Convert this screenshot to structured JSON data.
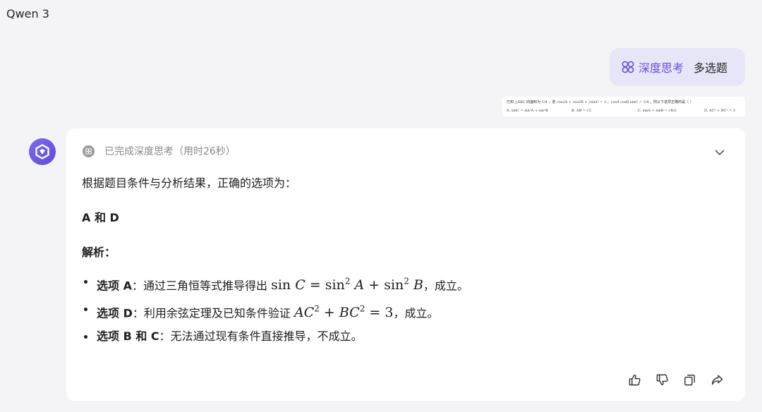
{
  "header": {
    "model_name": "Qwen 3"
  },
  "user_message": {
    "mode_label": "深度思考",
    "question_type": "多选题",
    "question_image": {
      "stem": "已知 △ABC 的面积为 1/4 ，若 cos2A + cos2B + 2sinC = 2 ，cosA cosB sinC = 1/4 ，则以下选项正确的是（ ）",
      "options": [
        "A. sinC = sin²A + sin²B",
        "B. AB = √2",
        "C. sinA + sinB = √6/2",
        "D. AC² + BC² = 3"
      ]
    }
  },
  "answer": {
    "thinking_status": "已完成深度思考（用时26秒）",
    "intro": "根据题目条件与分析结果，正确的选项为：",
    "result": "A 和 D",
    "analysis_heading": "解析：",
    "points": [
      {
        "label": "选项 A",
        "text": "：通过三角恒等式推导得出",
        "suffix": "，成立。"
      },
      {
        "label": "选项 D",
        "text": "：利用余弦定理及已知条件验证",
        "suffix": "，成立。"
      },
      {
        "label": "选项 B 和 C",
        "text": "：无法通过现有条件直接推导，不成立。",
        "suffix": ""
      }
    ]
  },
  "colors": {
    "accent": "#6b4fe0",
    "bubble_bg": "#e7e5f8",
    "page_bg": "#f4f4f6"
  },
  "icons": [
    "deep-think-icon",
    "qwen-logo-icon",
    "think-status-icon",
    "chevron-down-icon",
    "thumbs-up-icon",
    "thumbs-down-icon",
    "copy-icon",
    "share-icon"
  ]
}
